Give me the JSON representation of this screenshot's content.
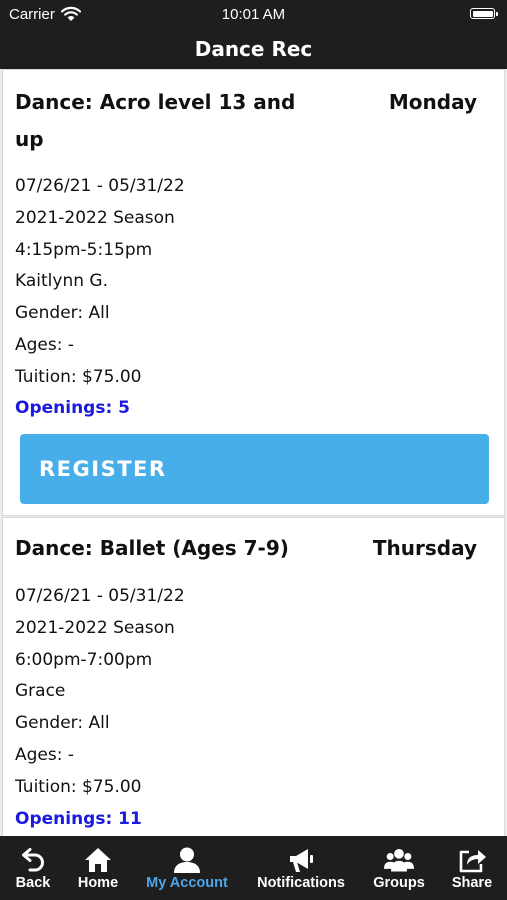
{
  "status_bar": {
    "carrier": "Carrier",
    "time": "10:01 AM"
  },
  "nav": {
    "title": "Dance Rec"
  },
  "classes": [
    {
      "title": "Dance: Acro level 13 and up",
      "day": "Monday",
      "date_range": "07/26/21 - 05/31/22",
      "season": "2021-2022 Season",
      "time": "4:15pm-5:15pm",
      "instructor": "Kaitlynn G.",
      "gender": "Gender: All",
      "ages": "Ages: -",
      "tuition": "Tuition: $75.00",
      "openings": "Openings: 5",
      "register_label": "REGISTER"
    },
    {
      "title": "Dance: Ballet (Ages 7-9)",
      "day": "Thursday",
      "date_range": "07/26/21 - 05/31/22",
      "season": "2021-2022 Season",
      "time": "6:00pm-7:00pm",
      "instructor": "Grace",
      "gender": "Gender: All",
      "ages": "Ages: -",
      "tuition": "Tuition: $75.00",
      "openings": "Openings: 11"
    }
  ],
  "tab_bar": {
    "active_tab": "My Account",
    "active_color": "#4da6e8",
    "tabs": [
      {
        "label": "Back",
        "icon": "back-arrow-icon"
      },
      {
        "label": "Home",
        "icon": "home-icon"
      },
      {
        "label": "My Account",
        "icon": "account-icon"
      },
      {
        "label": "Notifications",
        "icon": "megaphone-icon"
      },
      {
        "label": "Groups",
        "icon": "groups-icon"
      },
      {
        "label": "Share",
        "icon": "share-icon"
      }
    ]
  },
  "colors": {
    "bars": "#1e1e1e",
    "register_button": "#48aee9",
    "openings_text": "#1a1ae0"
  }
}
